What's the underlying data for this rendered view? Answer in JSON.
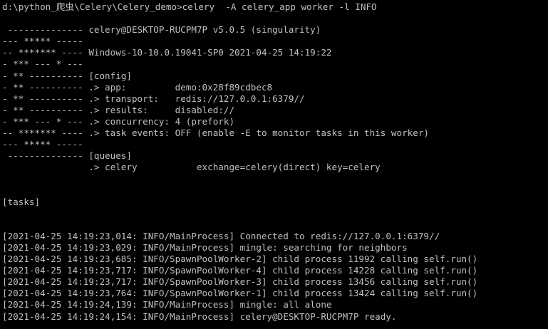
{
  "window": {
    "title": "",
    "background": "#000000",
    "foreground": "#c0c0c0"
  },
  "console": {
    "lines": [
      "d:\\python_爬虫\\Celery\\Celery_demo>celery  -A celery_app worker -l INFO",
      "",
      " -------------- celery@DESKTOP-RUCPM7P v5.0.5 (singularity)",
      "--- ***** -----",
      "-- ******* ---- Windows-10-10.0.19041-SP0 2021-04-25 14:19:22",
      "- *** --- * ---",
      "- ** ---------- [config]",
      "- ** ---------- .> app:         demo:0x28f89cdbec8",
      "- ** ---------- .> transport:   redis://127.0.0.1:6379//",
      "- ** ---------- .> results:     disabled://",
      "- *** --- * --- .> concurrency: 4 (prefork)",
      "-- ******* ---- .> task events: OFF (enable -E to monitor tasks in this worker)",
      "--- ***** -----",
      " -------------- [queues]",
      "                .> celery           exchange=celery(direct) key=celery",
      "",
      "",
      "[tasks]",
      "",
      "",
      "[2021-04-25 14:19:23,014: INFO/MainProcess] Connected to redis://127.0.0.1:6379//",
      "[2021-04-25 14:19:23,029: INFO/MainProcess] mingle: searching for neighbors",
      "[2021-04-25 14:19:23,685: INFO/SpawnPoolWorker-2] child process 11992 calling self.run()",
      "[2021-04-25 14:19:23,717: INFO/SpawnPoolWorker-4] child process 14228 calling self.run()",
      "[2021-04-25 14:19:23,717: INFO/SpawnPoolWorker-3] child process 13456 calling self.run()",
      "[2021-04-25 14:19:23,764: INFO/SpawnPoolWorker-1] child process 13424 calling self.run()",
      "[2021-04-25 14:19:24,139: INFO/MainProcess] mingle: all alone",
      "[2021-04-25 14:19:24,154: INFO/MainProcess] celery@DESKTOP-RUCPM7P ready."
    ]
  }
}
